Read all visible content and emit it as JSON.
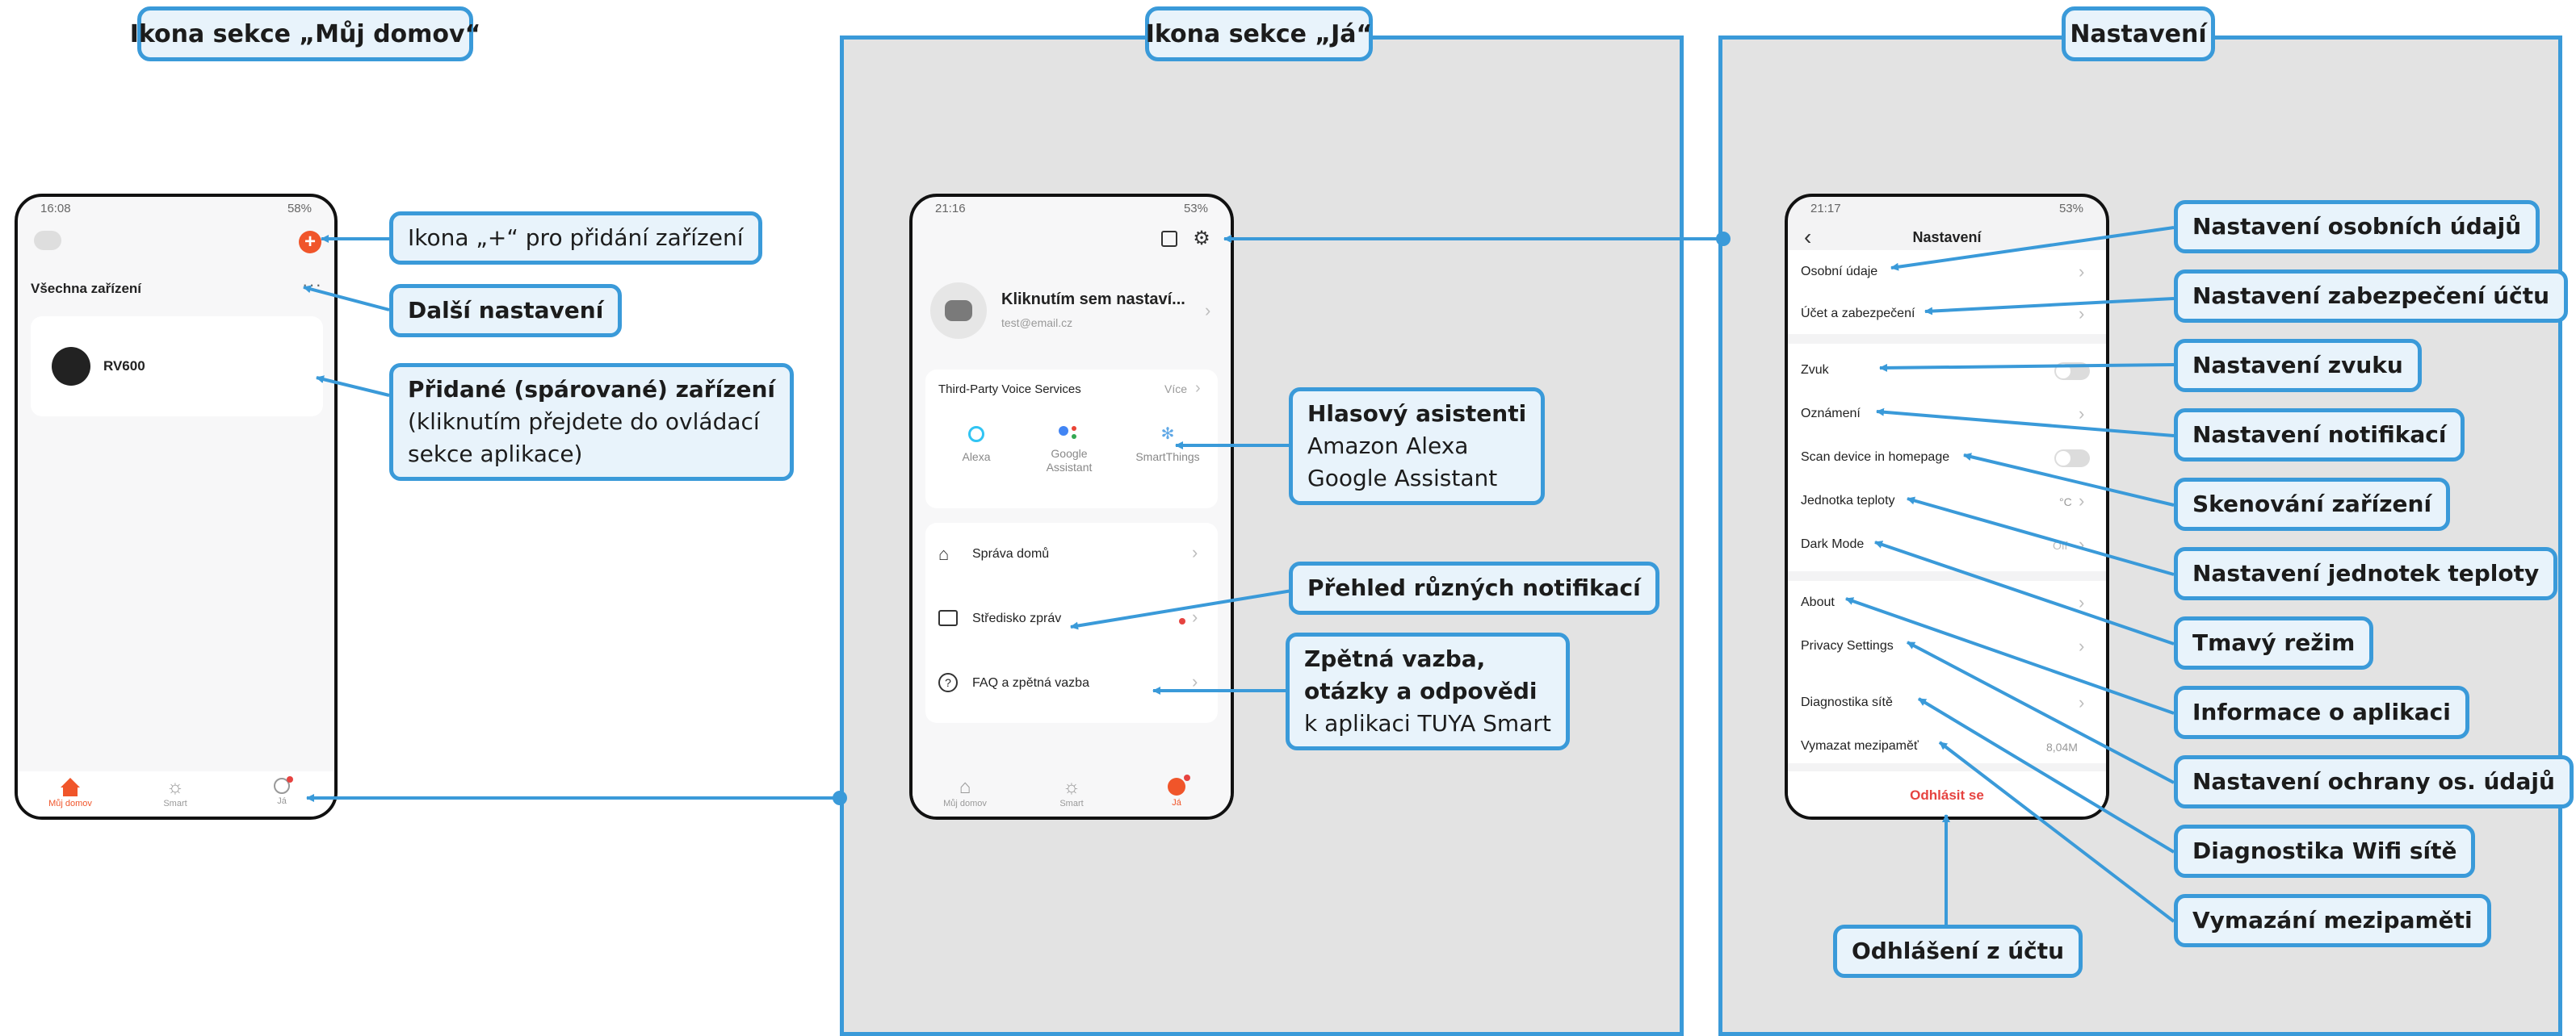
{
  "colors": {
    "accent": "#3a9ad9",
    "callout_bg": "#e8f3fb",
    "panel_bg": "#e3e3e3",
    "brand_orange": "#f0552a",
    "logout_red": "#e64340"
  },
  "sections": {
    "home_title": "Ikona sekce „Můj domov“",
    "me_title": "Ikona sekce „Já“",
    "settings_title": "Nastavení"
  },
  "phone_home": {
    "status_time": "16:08",
    "status_right": "58%",
    "all_devices": "Všechna zařízení",
    "device_name": "RV600",
    "tabs": [
      {
        "label": "Můj domov",
        "icon": "home-icon"
      },
      {
        "label": "Smart",
        "icon": "sun-icon"
      },
      {
        "label": "Já",
        "icon": "person-icon"
      }
    ]
  },
  "phone_me": {
    "status_time": "21:16",
    "status_right": "53%",
    "profile_name": "Kliknutím sem nastaví...",
    "profile_email": "test@email.cz",
    "voice_title": "Third-Party Voice Services",
    "voice_more": "Více",
    "voice_items": [
      {
        "label": "Alexa",
        "icon": "alexa-icon"
      },
      {
        "label": "Google Assistant",
        "icon": "google-assistant-icon"
      },
      {
        "label": "SmartThings",
        "icon": "smartthings-icon"
      }
    ],
    "menu": [
      {
        "label": "Správa domů",
        "icon": "house-icon"
      },
      {
        "label": "Středisko zpráv",
        "icon": "message-icon"
      },
      {
        "label": "FAQ a zpětná vazba",
        "icon": "help-icon"
      }
    ],
    "tabs": [
      {
        "label": "Můj domov",
        "icon": "home-icon"
      },
      {
        "label": "Smart",
        "icon": "sun-icon"
      },
      {
        "label": "Já",
        "icon": "person-icon"
      }
    ]
  },
  "phone_settings": {
    "status_time": "21:17",
    "status_right": "53%",
    "title": "Nastavení",
    "rows": [
      {
        "label": "Osobní údaje",
        "value": ""
      },
      {
        "label": "Účet a zabezpečení",
        "value": ""
      },
      {
        "label": "Zvuk",
        "value": ""
      },
      {
        "label": "Oznámení",
        "value": ""
      },
      {
        "label": "Scan device in homepage",
        "value": ""
      },
      {
        "label": "Jednotka teploty",
        "value": "°C"
      },
      {
        "label": "Dark Mode",
        "value": "Off"
      },
      {
        "label": "About",
        "value": ""
      },
      {
        "label": "Privacy Settings",
        "value": ""
      },
      {
        "label": "Diagnostika sítě",
        "value": ""
      },
      {
        "label": "Vymazat mezipaměť",
        "value": "8,04M"
      }
    ],
    "logout": "Odhlásit se"
  },
  "callouts": {
    "add": "Ikona „+“ pro přidání zařízení",
    "more": "Další nastavení",
    "added_bold": "Přidané (spárované) zařízení",
    "added_l2": "(kliknutím přejdete do ovládací",
    "added_l3": "sekce aplikace)",
    "voice_bold": "Hlasový asistenti",
    "voice_l2": "Amazon Alexa",
    "voice_l3": "Google Assistant",
    "notif": "Přehled různých notifikací",
    "faq_l1": "Zpětná vazba,",
    "faq_l2": "otázky a odpovědi",
    "faq_l3": "k aplikaci TUYA Smart",
    "set_personal": "Nastavení osobních údajů",
    "set_security": "Nastavení zabezpečení účtu",
    "set_sound": "Nastavení zvuku",
    "set_notif": "Nastavení notifikací",
    "set_scan": "Skenování zařízení",
    "set_temp": "Nastavení jednotek teploty",
    "set_dark": "Tmavý režim",
    "set_about": "Informace o aplikaci",
    "set_privacy": "Nastavení ochrany os. údajů",
    "set_diag": "Diagnostika Wifi sítě",
    "set_cache": "Vymazání mezipaměti",
    "set_logout": "Odhlášení z účtu"
  }
}
